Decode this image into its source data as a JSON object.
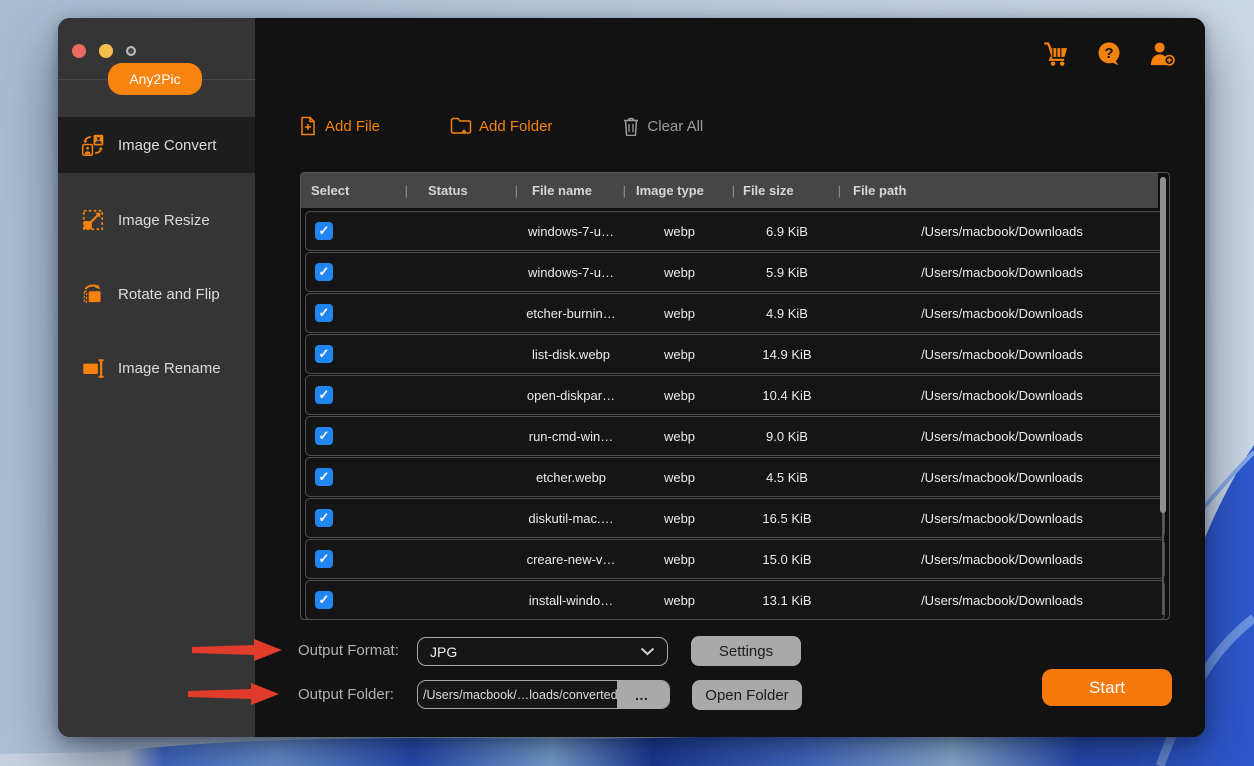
{
  "window": {
    "badge": "Any2Pic",
    "traffic_lights": [
      "close",
      "minimize",
      "zoom"
    ]
  },
  "topbar": {
    "icons": [
      {
        "name": "cart-icon"
      },
      {
        "name": "help-icon"
      },
      {
        "name": "add-user-icon"
      }
    ]
  },
  "sidebar": {
    "items": [
      {
        "label": "Image Convert",
        "icon": "image-convert-icon",
        "active": true
      },
      {
        "label": "Image Resize",
        "icon": "image-resize-icon",
        "active": false
      },
      {
        "label": "Rotate and Flip",
        "icon": "rotate-flip-icon",
        "active": false
      },
      {
        "label": "Image Rename",
        "icon": "image-rename-icon",
        "active": false
      }
    ]
  },
  "toolbar": {
    "add_file": "Add File",
    "add_folder": "Add Folder",
    "clear_all": "Clear All"
  },
  "table": {
    "separator": "|",
    "checkbox_glyph": "✓",
    "headers": [
      "Select",
      "Status",
      "File name",
      "Image type",
      "File size",
      "File path"
    ],
    "rows": [
      {
        "checked": true,
        "status": "",
        "name": "windows-7-u…",
        "type": "webp",
        "size": "6.9 KiB",
        "path": "/Users/macbook/Downloads"
      },
      {
        "checked": true,
        "status": "",
        "name": "windows-7-u…",
        "type": "webp",
        "size": "5.9 KiB",
        "path": "/Users/macbook/Downloads"
      },
      {
        "checked": true,
        "status": "",
        "name": "etcher-burnin…",
        "type": "webp",
        "size": "4.9 KiB",
        "path": "/Users/macbook/Downloads"
      },
      {
        "checked": true,
        "status": "",
        "name": "list-disk.webp",
        "type": "webp",
        "size": "14.9 KiB",
        "path": "/Users/macbook/Downloads"
      },
      {
        "checked": true,
        "status": "",
        "name": "open-diskpar…",
        "type": "webp",
        "size": "10.4 KiB",
        "path": "/Users/macbook/Downloads"
      },
      {
        "checked": true,
        "status": "",
        "name": "run-cmd-win…",
        "type": "webp",
        "size": "9.0 KiB",
        "path": "/Users/macbook/Downloads"
      },
      {
        "checked": true,
        "status": "",
        "name": "etcher.webp",
        "type": "webp",
        "size": "4.5 KiB",
        "path": "/Users/macbook/Downloads"
      },
      {
        "checked": true,
        "status": "",
        "name": "diskutil-mac.…",
        "type": "webp",
        "size": "16.5 KiB",
        "path": "/Users/macbook/Downloads"
      },
      {
        "checked": true,
        "status": "",
        "name": "creare-new-v…",
        "type": "webp",
        "size": "15.0 KiB",
        "path": "/Users/macbook/Downloads"
      },
      {
        "checked": true,
        "status": "",
        "name": "install-windo…",
        "type": "webp",
        "size": "13.1 KiB",
        "path": "/Users/macbook/Downloads"
      }
    ]
  },
  "output": {
    "format_label": "Output Format:",
    "format_value": "JPG",
    "settings_label": "Settings",
    "folder_label": "Output Folder:",
    "folder_value": "/Users/macbook/…loads/converted",
    "browse_label": "…",
    "open_folder_label": "Open Folder",
    "start_label": "Start"
  },
  "colors": {
    "accent_orange": "#F5820D",
    "badge_orange": "#F8830E",
    "start_orange": "#F8790B",
    "checkbox_blue": "#2186F0",
    "arrow_red": "#E13B2B",
    "sidebar_gray": "#353535",
    "header_gray": "#464646"
  }
}
